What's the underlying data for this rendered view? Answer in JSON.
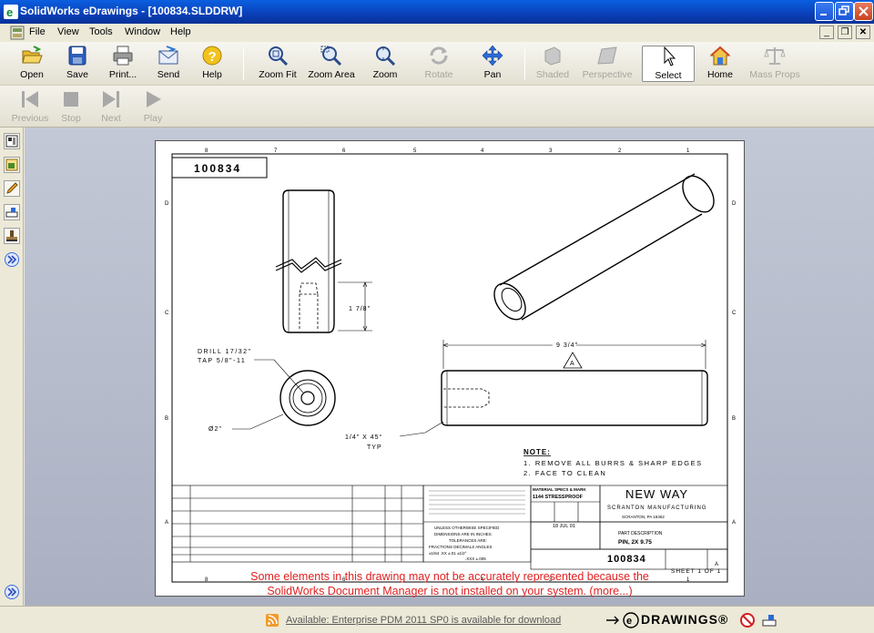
{
  "window": {
    "title": "SolidWorks eDrawings - [100834.SLDDRW]"
  },
  "menu": [
    "File",
    "View",
    "Tools",
    "Window",
    "Help"
  ],
  "toolbar_main": {
    "open": "Open",
    "save": "Save",
    "print": "Print...",
    "send": "Send",
    "help": "Help",
    "zoom_fit": "Zoom Fit",
    "zoom_area": "Zoom Area",
    "zoom": "Zoom",
    "rotate": "Rotate",
    "pan": "Pan",
    "shaded": "Shaded",
    "perspective": "Perspective",
    "select": "Select",
    "home": "Home",
    "mass_props": "Mass Props"
  },
  "toolbar_play": {
    "previous": "Previous",
    "stop": "Stop",
    "next": "Next",
    "play": "Play"
  },
  "drawing": {
    "part_number": "100834",
    "zone_cols": [
      "8",
      "7",
      "6",
      "5",
      "4",
      "3",
      "2",
      "1"
    ],
    "zone_rows": [
      "D",
      "C",
      "B",
      "A"
    ],
    "dim_height": "1 7/8\"",
    "dim_length": "9 3/4\"",
    "callout_drill": "DRILL 17/32\"",
    "callout_tap": "TAP 5/8\"-11",
    "dim_diameter": "Ø2\"",
    "chamfer": "1/4\" X 45°",
    "chamfer_typ": "TYP",
    "datum": "A",
    "notes_title": "NOTE:",
    "note1": "1.   REMOVE ALL BURRS & SHARP EDGES",
    "note2": "2.   FACE TO CLEAN",
    "company": "NEW WAY",
    "company_sub": "SCRANTON MANUFACTURING",
    "company_city": "SCRANTON, PA 18462",
    "material_label": "MATERIAL SPECS & MARK",
    "material": "1144 STRESSPROOF",
    "date": "18 JUL 01",
    "part_desc_label": "PART DESCRIPTION",
    "part_desc": "PIN, 2X 9.75",
    "rev": "A",
    "sheet": "SHEET  1  OF  1",
    "tol_1": "UNLESS OTHERWISE SPECIFIED",
    "tol_2": "DIMENSIONS ARE IN INCHES",
    "tol_3": "TOLERANCES ARE:",
    "tol_4": "FRACTIONS   DECIMALS   ANGLES",
    "tol_5": "±1/64    .XX ±.01    ±1/2°",
    "tol_6": ".XXX ±.005"
  },
  "warning_line1": "Some elements in this drawing may not be accurately represented because the",
  "warning_line2": "SolidWorks Document Manager is not installed on your system. (more...)",
  "status": {
    "message": "Available: Enterprise PDM 2011 SP0 is available for download",
    "brand": "DRAWINGS®"
  }
}
